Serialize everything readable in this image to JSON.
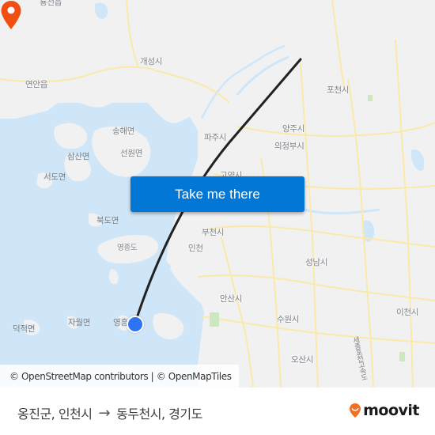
{
  "map": {
    "labels": {
      "yeonchoneup": "룡천읍",
      "gaeseong": "개성시",
      "yeonan": "연안읍",
      "songhae": "송해면",
      "seonwon": "선원면",
      "samsan": "삼산면",
      "seodo": "서도면",
      "paju": "파주시",
      "goyang": "고양시",
      "yangju": "양주시",
      "uijeongbu": "의정부시",
      "pocheon": "포천시",
      "bukdo": "북도면",
      "yeongjongdo": "영종도",
      "bucheon": "부천시",
      "incheon": "인천",
      "seongnam": "성남시",
      "ansan": "안산시",
      "suwon": "수원시",
      "icheon": "이천시",
      "osan": "오산시",
      "jawol": "자월면",
      "deokjeok": "덕적면",
      "yeongheung": "영흥",
      "expressway": "세종포천고속도"
    },
    "origin_marker": "origin-dot",
    "destination_marker": "destination-pin-icon",
    "colors": {
      "land": "#f1f1f2",
      "water": "#cfe6f8",
      "road": "#fbe9a9",
      "route_line": "#222222",
      "pin": "#f04e12",
      "origin": "#2f73f5",
      "cta": "#0277d6",
      "brand": "#f36f21"
    }
  },
  "cta": {
    "label": "Take me there"
  },
  "attribution": {
    "text": "© OpenStreetMap contributors | © OpenMapTiles"
  },
  "footer": {
    "origin": "옹진군, 인천시",
    "arrow": "→",
    "destination": "동두천시, 경기도",
    "brand": "moovit"
  }
}
